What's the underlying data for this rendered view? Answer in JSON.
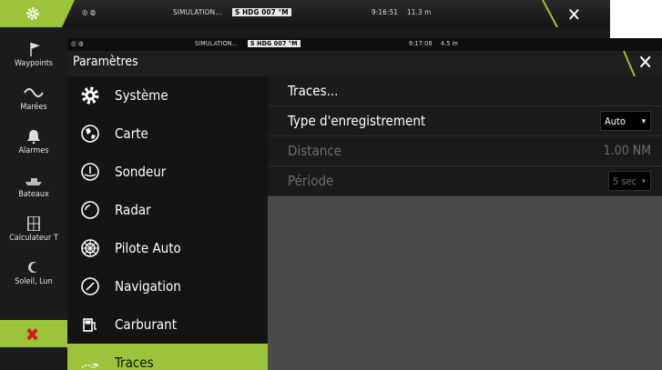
{
  "background_window": {
    "status": {
      "simulation": "SIMULATION...",
      "hdg_label": "S HDG 007 °M",
      "time": "9:16:51",
      "distance": "11.3 m"
    },
    "sidebar": [
      {
        "label": "Waypoints",
        "icon": "flag-icon"
      },
      {
        "label": "Marées",
        "icon": "wave-icon"
      },
      {
        "label": "Alarmes",
        "icon": "bell-icon"
      },
      {
        "label": "Bateaux",
        "icon": "boat-icon"
      },
      {
        "label": "Calculateur T",
        "icon": "calculator-icon"
      },
      {
        "label": "Soleil, Lun",
        "icon": "sun-moon-icon"
      }
    ]
  },
  "foreground_window": {
    "status": {
      "simulation": "SIMULATION...",
      "hdg_label": "S HDG 007 °M",
      "time": "9:17:08",
      "distance": "4.5 m"
    },
    "title": "Paramètres",
    "menu": [
      {
        "label": "Système",
        "icon": "gear-icon"
      },
      {
        "label": "Carte",
        "icon": "globe-icon"
      },
      {
        "label": "Sondeur",
        "icon": "sonar-icon"
      },
      {
        "label": "Radar",
        "icon": "radar-icon"
      },
      {
        "label": "Pilote Auto",
        "icon": "wheel-icon"
      },
      {
        "label": "Navigation",
        "icon": "compass-icon"
      },
      {
        "label": "Carburant",
        "icon": "fuel-icon"
      },
      {
        "label": "Traces",
        "icon": "trail-icon",
        "active": true
      }
    ],
    "settings": {
      "header": "Traces...",
      "rows": [
        {
          "label": "Type d'enregistrement",
          "value": "Auto",
          "type": "dropdown",
          "enabled": true
        },
        {
          "label": "Distance",
          "value": "1.00 NM",
          "type": "value",
          "enabled": false
        },
        {
          "label": "Période",
          "value": "5 sec",
          "type": "dropdown",
          "enabled": false
        }
      ]
    }
  },
  "colors": {
    "accent": "#9cc43a",
    "close_red": "#d41c1c",
    "panel": "#1a1a1a",
    "content_bg": "#4a4a4a"
  }
}
